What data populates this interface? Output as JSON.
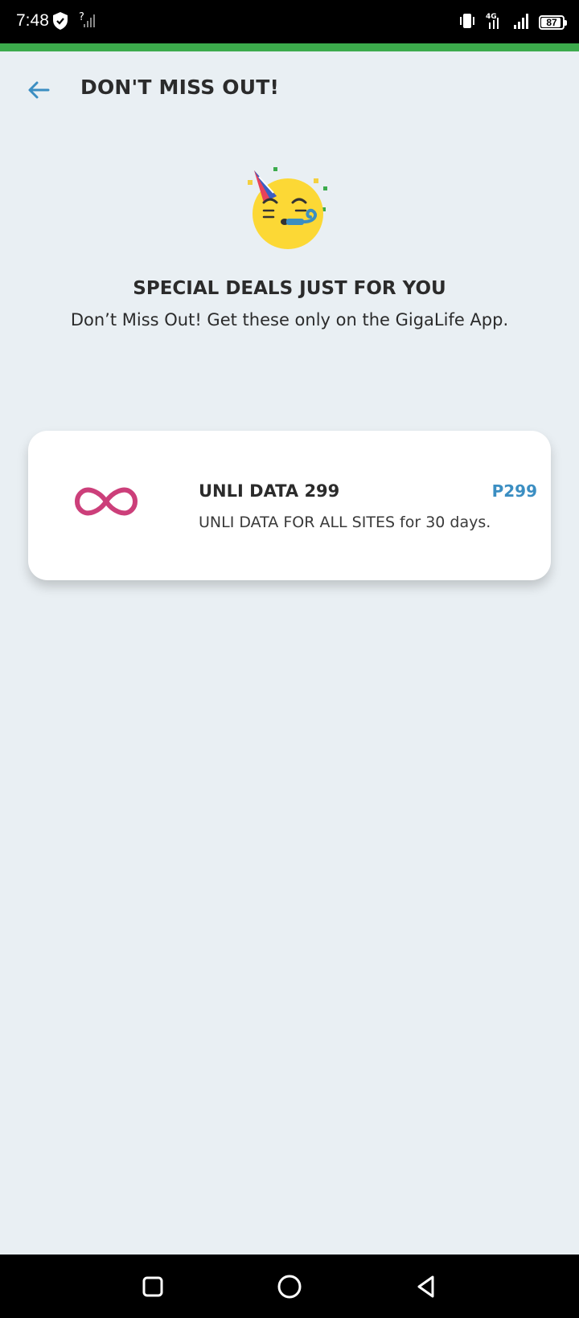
{
  "status_bar": {
    "time": "7:48",
    "battery_level": "87",
    "network_type": "4G"
  },
  "header": {
    "title": "DON'T MISS OUT!"
  },
  "promo": {
    "emoji": "party-face-icon",
    "heading": "SPECIAL DEALS JUST FOR YOU",
    "subtitle": "Don’t Miss Out! Get these only on the GigaLife App."
  },
  "deals": [
    {
      "icon": "infinity-icon",
      "name": "UNLI DATA 299",
      "price": "P299",
      "description": "UNLI DATA FOR ALL SITES for 30 days."
    }
  ],
  "colors": {
    "background": "#e9eff3",
    "accent_green": "#3cab4c",
    "price_blue": "#3b8ec2",
    "infinity_pink": "#cc3f7a",
    "back_arrow_blue": "#3b8ec2"
  }
}
